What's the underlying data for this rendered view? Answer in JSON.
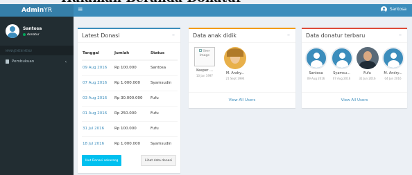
{
  "heading": "Halaman Beranda Donatur",
  "brand": {
    "part1": "Admin",
    "part2": "YR"
  },
  "topbar": {
    "toggle_icon": "hamburger-icon",
    "user_name": "Santosa"
  },
  "sidebar": {
    "user": {
      "name": "Santosa",
      "role": "donatur",
      "status_color": "#00a65a"
    },
    "menu_header": "MANAJEMEN MENU",
    "items": [
      {
        "label": "Pembukuan",
        "icon": "book-icon"
      }
    ]
  },
  "donations": {
    "title": "Latest Donasi",
    "columns": [
      "Tanggal",
      "Jumlah",
      "Status"
    ],
    "rows": [
      {
        "date": "09 Aug 2016",
        "amount": "Rp 100.000",
        "status": "Santosa"
      },
      {
        "date": "07 Aug 2016",
        "amount": "Rp 1.000.000",
        "status": "Syamsudin"
      },
      {
        "date": "03 Aug 2016",
        "amount": "Rp 30.000.000",
        "status": "Fufu"
      },
      {
        "date": "01 Aug 2016",
        "amount": "Rp 250.000",
        "status": "Fufu"
      },
      {
        "date": "31 Jul 2016",
        "amount": "Rp 100.000",
        "status": "Fufu"
      },
      {
        "date": "18 Jul 2016",
        "amount": "Rp 1.000.000",
        "status": "Syamsudin"
      }
    ],
    "primary_button": "Ikut Donasi sekarang",
    "secondary_button": "Lihat data donasi"
  },
  "students": {
    "title": "Data anak didik",
    "broken_image_alt": "User Image",
    "users": [
      {
        "name": "Keeper ...",
        "date": "10 Jan 1997"
      },
      {
        "name": "M. Andry...",
        "date": "21 Sept 1994"
      }
    ],
    "view_all": "View All Users"
  },
  "donors": {
    "title": "Data donatur terbaru",
    "users": [
      {
        "name": "Santosa",
        "date": "09 Aug 2016"
      },
      {
        "name": "Syamsu...",
        "date": "07 Aug 2016"
      },
      {
        "name": "Fufu",
        "date": "31 Jun 2016"
      },
      {
        "name": "M. Andry...",
        "date": "04 Jun 2016"
      }
    ],
    "view_all": "View All Users"
  },
  "colors": {
    "primary": "#3c8dbc",
    "sidebar": "#222d32",
    "info": "#00c0ef",
    "warning": "#f39c12",
    "danger": "#dd4b39"
  }
}
